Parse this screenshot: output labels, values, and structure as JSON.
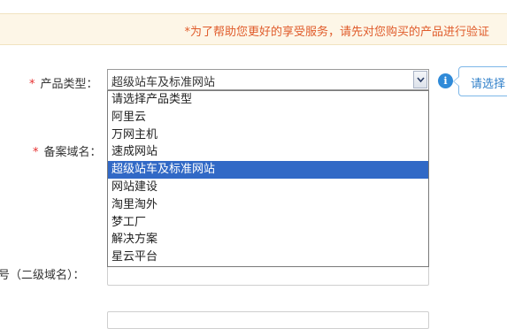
{
  "notice": {
    "text": "*为了帮助您更好的享受服务，请先对您购买的产品进行验证"
  },
  "form": {
    "product_type": {
      "required_mark": "*",
      "label": "产品类型：",
      "selected_value": "超级站车及标准网站",
      "options": [
        "请选择产品类型",
        "阿里云",
        "万网主机",
        "速成网站",
        "超级站车及标准网站",
        "网站建设",
        "淘里淘外",
        "梦工厂",
        "解决方案",
        "星云平台"
      ],
      "highlighted_index": 4
    },
    "domain": {
      "required_mark": "*",
      "label": "备案域名："
    },
    "subdomain_account": {
      "label": "号（二级域名）："
    }
  },
  "tooltip": {
    "icon": "info-icon",
    "text": "请选择"
  }
}
